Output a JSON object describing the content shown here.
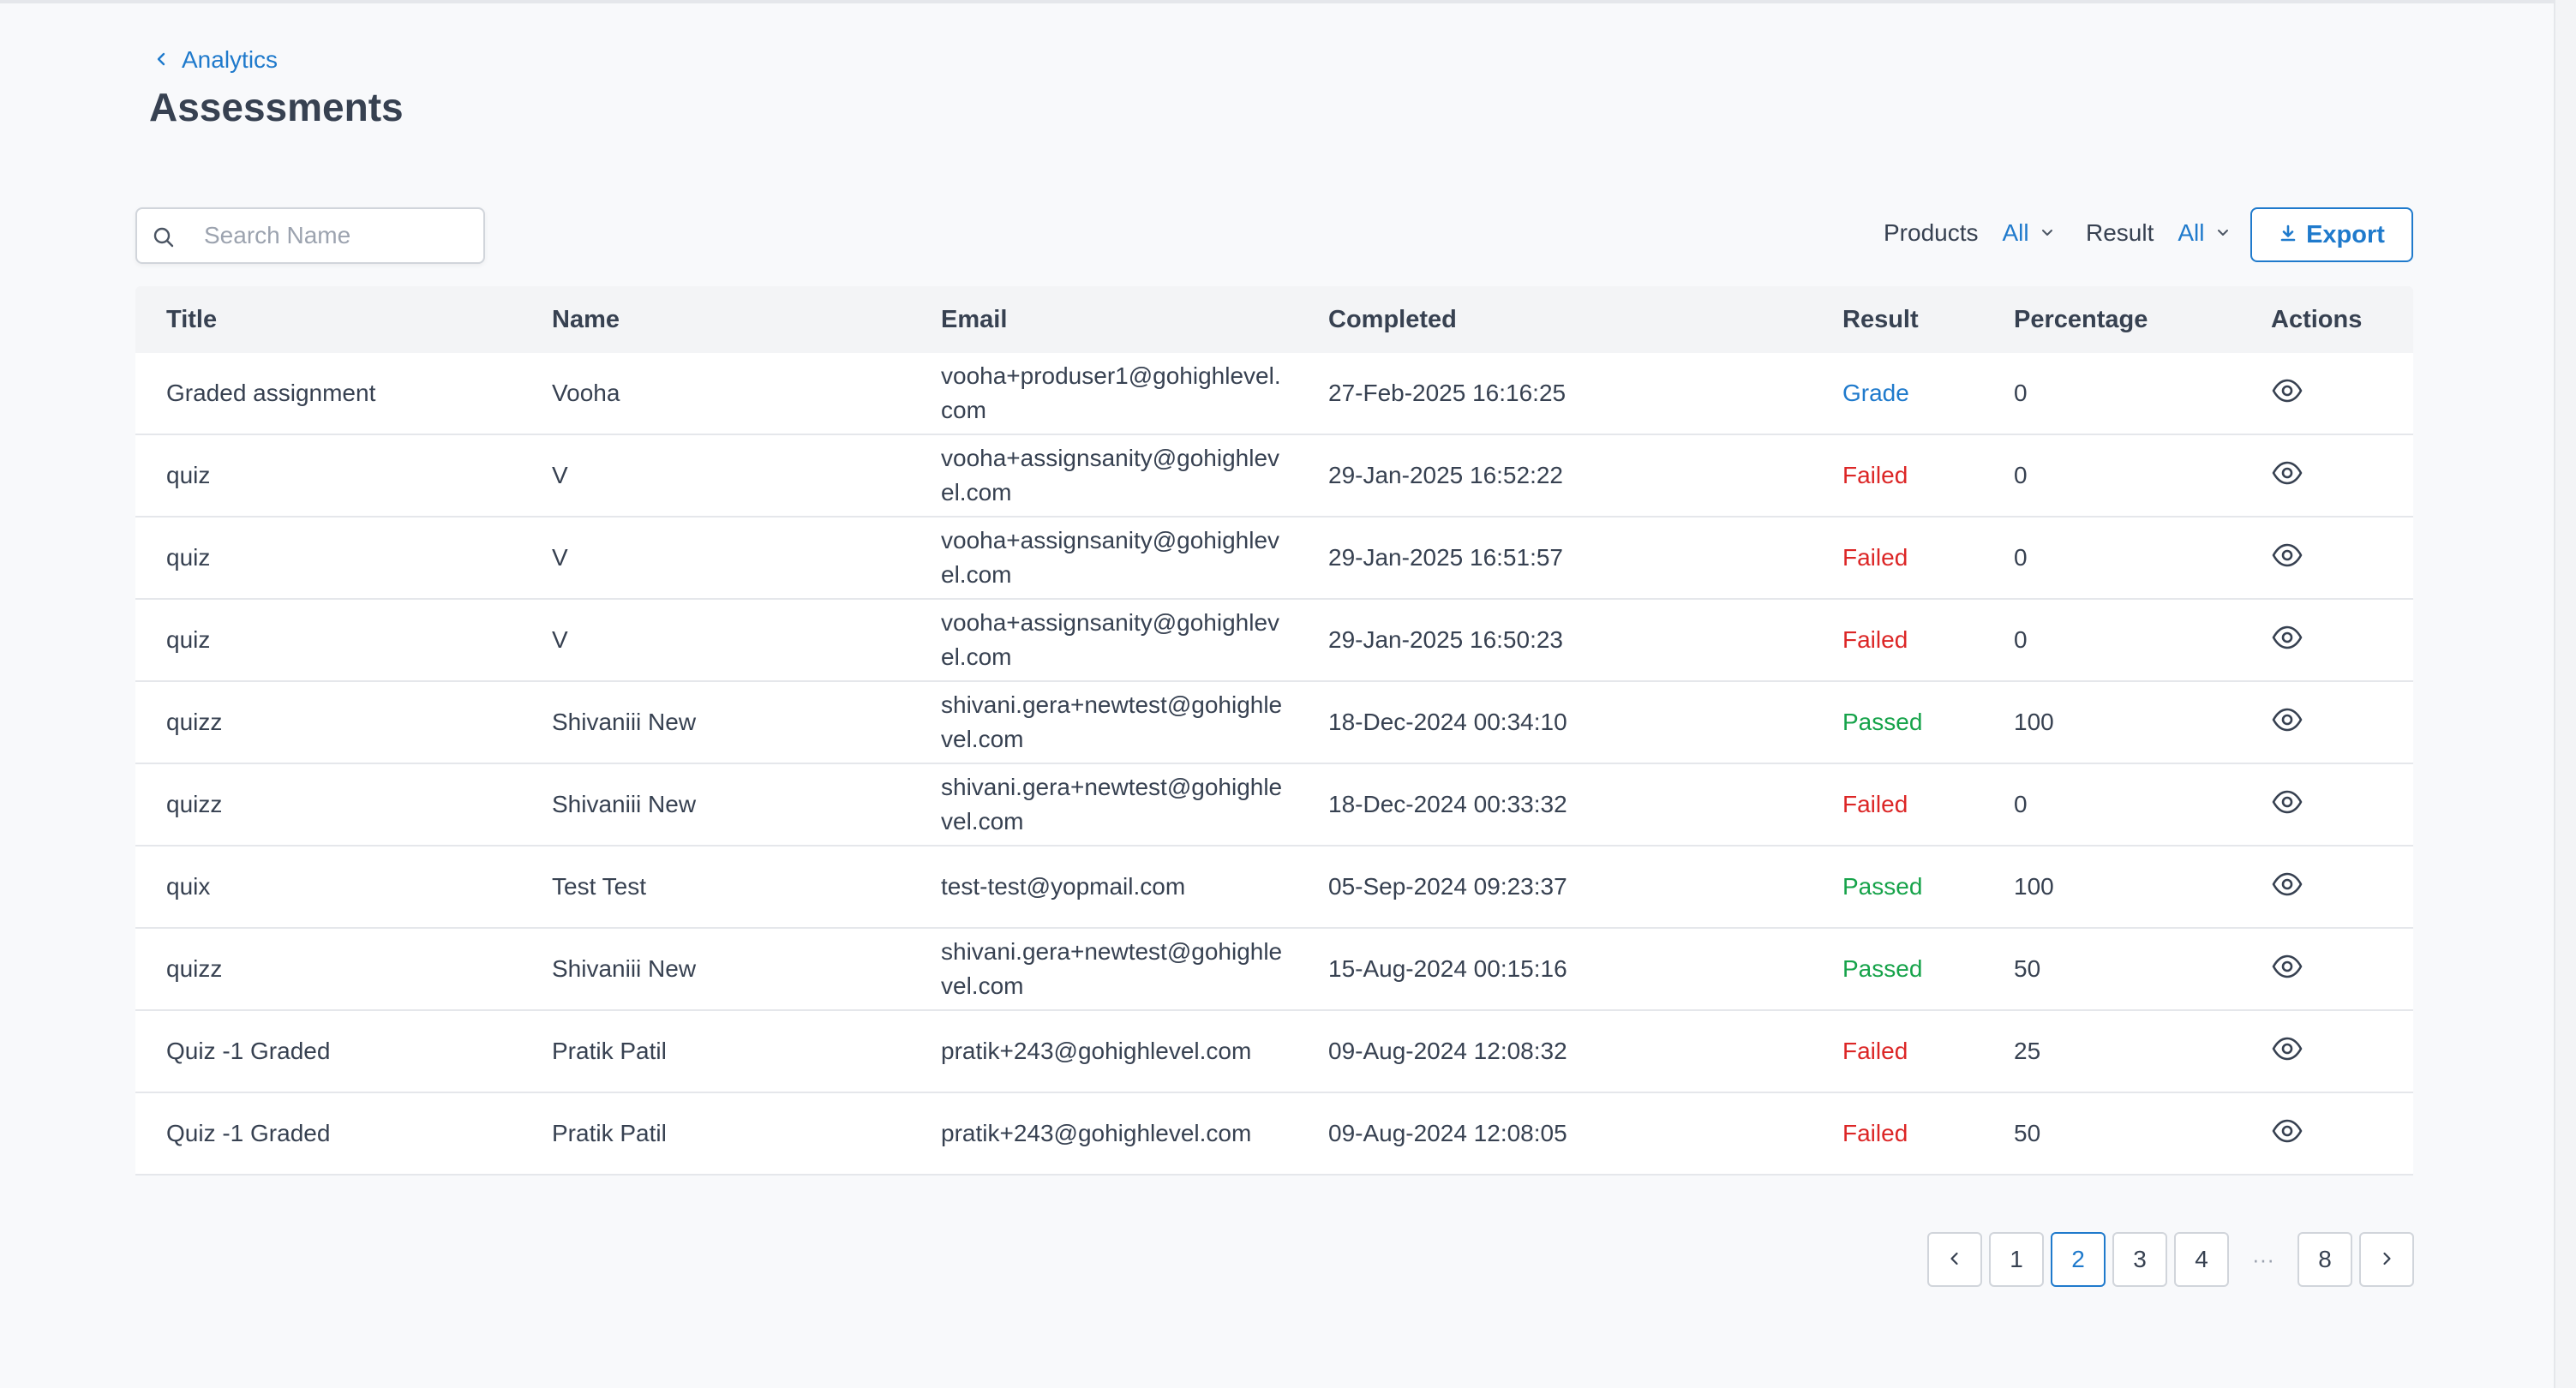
{
  "breadcrumb": {
    "label": "Analytics"
  },
  "page": {
    "title": "Assessments"
  },
  "search": {
    "placeholder": "Search Name",
    "value": ""
  },
  "filters": {
    "products": {
      "label": "Products",
      "value": "All"
    },
    "result": {
      "label": "Result",
      "value": "All"
    }
  },
  "export": {
    "label": "Export"
  },
  "table": {
    "columns": [
      "Title",
      "Name",
      "Email",
      "Completed",
      "Result",
      "Percentage",
      "Actions"
    ],
    "rows": [
      {
        "title": "Graded assignment",
        "name": "Vooha",
        "email": "vooha+produser1@gohighlevel.com",
        "completed": "27-Feb-2025 16:16:25",
        "result": "Grade",
        "percentage": "0"
      },
      {
        "title": "quiz",
        "name": "V",
        "email": "vooha+assignsanity@gohighlevel.com",
        "completed": "29-Jan-2025 16:52:22",
        "result": "Failed",
        "percentage": "0"
      },
      {
        "title": "quiz",
        "name": "V",
        "email": "vooha+assignsanity@gohighlevel.com",
        "completed": "29-Jan-2025 16:51:57",
        "result": "Failed",
        "percentage": "0"
      },
      {
        "title": "quiz",
        "name": "V",
        "email": "vooha+assignsanity@gohighlevel.com",
        "completed": "29-Jan-2025 16:50:23",
        "result": "Failed",
        "percentage": "0"
      },
      {
        "title": "quizz",
        "name": "Shivaniii New",
        "email": "shivani.gera+newtest@gohighlevel.com",
        "completed": "18-Dec-2024 00:34:10",
        "result": "Passed",
        "percentage": "100"
      },
      {
        "title": "quizz",
        "name": "Shivaniii New",
        "email": "shivani.gera+newtest@gohighlevel.com",
        "completed": "18-Dec-2024 00:33:32",
        "result": "Failed",
        "percentage": "0"
      },
      {
        "title": "quix",
        "name": "Test Test",
        "email": "test-test@yopmail.com",
        "completed": "05-Sep-2024 09:23:37",
        "result": "Passed",
        "percentage": "100"
      },
      {
        "title": "quizz",
        "name": "Shivaniii New",
        "email": "shivani.gera+newtest@gohighlevel.com",
        "completed": "15-Aug-2024 00:15:16",
        "result": "Passed",
        "percentage": "50"
      },
      {
        "title": "Quiz -1 Graded",
        "name": "Pratik Patil",
        "email": "pratik+243@gohighlevel.com",
        "completed": "09-Aug-2024 12:08:32",
        "result": "Failed",
        "percentage": "25"
      },
      {
        "title": "Quiz -1 Graded",
        "name": "Pratik Patil",
        "email": "pratik+243@gohighlevel.com",
        "completed": "09-Aug-2024 12:08:05",
        "result": "Failed",
        "percentage": "50"
      }
    ]
  },
  "pagination": {
    "pages": [
      "1",
      "2",
      "3",
      "4",
      "8"
    ],
    "current": "2",
    "ellipsis": "···"
  },
  "icons": {
    "back": "chevron-left-icon",
    "search": "search-icon",
    "dropdown": "chevron-down-icon",
    "export": "download-icon",
    "view": "eye-icon",
    "prev": "chevron-left-icon",
    "next": "chevron-right-icon"
  },
  "colors": {
    "accent": "#1f7acc",
    "failed": "#dc2626",
    "passed": "#16a34a",
    "text": "#374151",
    "placeholder": "#9ca3af"
  }
}
